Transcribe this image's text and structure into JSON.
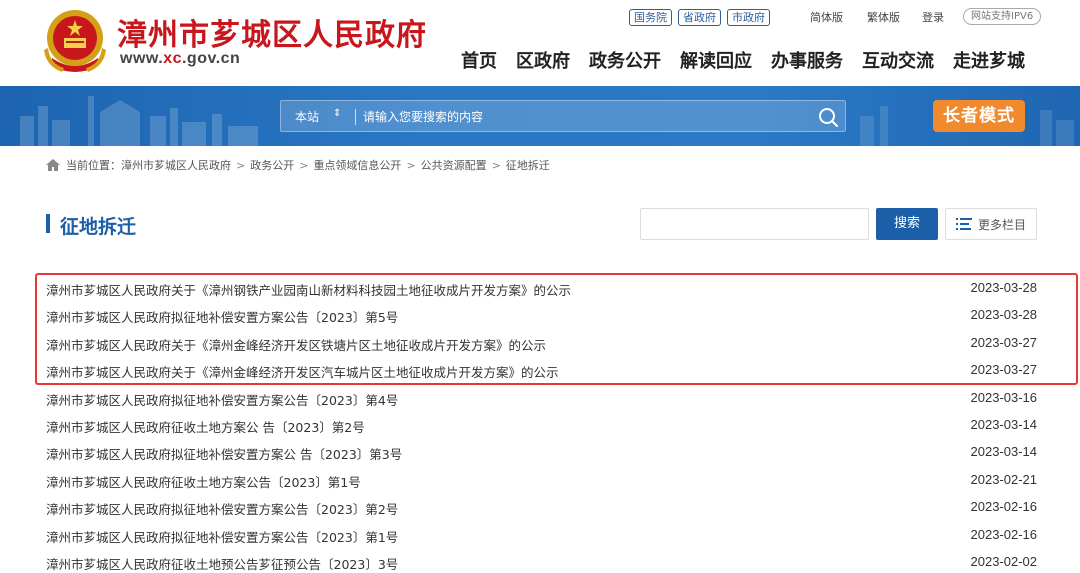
{
  "header": {
    "site_title": "漳州市芗城区人民政府",
    "url_prefix": "www.",
    "url_highlight": "xc",
    "url_suffix": ".gov.cn",
    "top_links": [
      "国务院",
      "省政府",
      "市政府"
    ],
    "simplified": "简体版",
    "traditional": "繁体版",
    "login": "登录",
    "ipv6": "网站支持IPV6",
    "nav": [
      "首页",
      "区政府",
      "政务公开",
      "解读回应",
      "办事服务",
      "互动交流",
      "走进芗城"
    ]
  },
  "banner": {
    "search_scope": "本站",
    "search_placeholder": "请输入您要搜索的内容",
    "elder_mode": "长者模式"
  },
  "breadcrumb": {
    "label": "当前位置：",
    "items": [
      "漳州市芗城区人民政府",
      "政务公开",
      "重点领域信息公开",
      "公共资源配置",
      "征地拆迁"
    ],
    "separator": ">"
  },
  "section": {
    "title": "征地拆迁",
    "search_button": "搜索",
    "more_columns": "更多栏目"
  },
  "list": [
    {
      "title": "漳州市芗城区人民政府关于《漳州钢铁产业园南山新材料科技园土地征收成片开发方案》的公示",
      "date": "2023-03-28"
    },
    {
      "title": "漳州市芗城区人民政府拟征地补偿安置方案公告〔2023〕第5号",
      "date": "2023-03-28"
    },
    {
      "title": "漳州市芗城区人民政府关于《漳州金峰经济开发区铁塘片区土地征收成片开发方案》的公示",
      "date": "2023-03-27"
    },
    {
      "title": "漳州市芗城区人民政府关于《漳州金峰经济开发区汽车城片区土地征收成片开发方案》的公示",
      "date": "2023-03-27"
    },
    {
      "title": "漳州市芗城区人民政府拟征地补偿安置方案公告〔2023〕第4号",
      "date": "2023-03-16"
    },
    {
      "title": "漳州市芗城区人民政府征收土地方案公 告〔2023〕第2号",
      "date": "2023-03-14"
    },
    {
      "title": "漳州市芗城区人民政府拟征地补偿安置方案公 告〔2023〕第3号",
      "date": "2023-03-14"
    },
    {
      "title": "漳州市芗城区人民政府征收土地方案公告〔2023〕第1号",
      "date": "2023-02-21"
    },
    {
      "title": "漳州市芗城区人民政府拟征地补偿安置方案公告〔2023〕第2号",
      "date": "2023-02-16"
    },
    {
      "title": "漳州市芗城区人民政府拟征地补偿安置方案公告〔2023〕第1号",
      "date": "2023-02-16"
    },
    {
      "title": "漳州市芗城区人民政府征收土地预公告芗征预公告〔2023〕3号",
      "date": "2023-02-02"
    }
  ],
  "colors": {
    "brand_red": "#c8161d",
    "brand_blue": "#1d5ea8",
    "elder_orange": "#f08a2c",
    "highlight_red": "#e53935"
  }
}
